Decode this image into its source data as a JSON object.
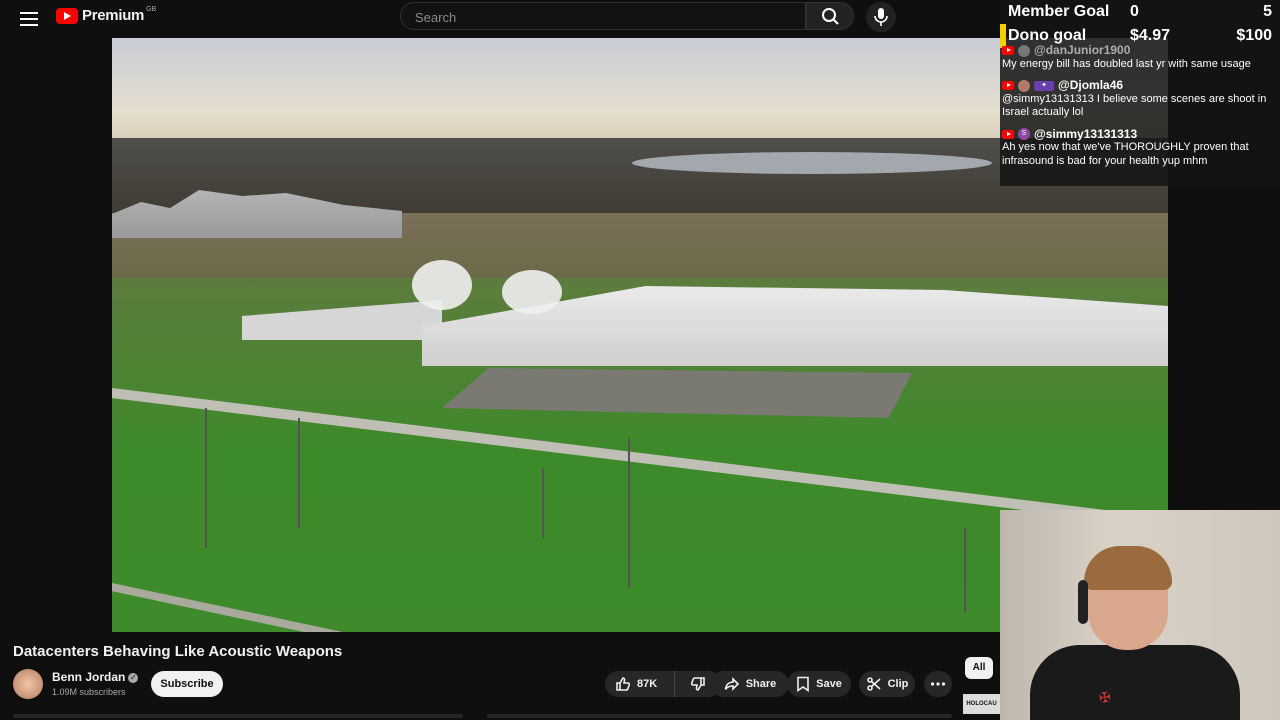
{
  "header": {
    "menu_icon": "hamburger-icon",
    "logo_text": "Premium",
    "logo_region": "GB",
    "search_placeholder": "Search",
    "search_icon": "search-icon",
    "mic_icon": "mic-icon"
  },
  "overlay": {
    "member_goal": {
      "label": "Member Goal",
      "current": "0",
      "target": "5"
    },
    "dono_goal": {
      "label": "Dono goal",
      "current": "$4.97",
      "target": "$100"
    },
    "chat": [
      {
        "user": "@danJunior1900",
        "text": "My energy bill has doubled last yr with same usage"
      },
      {
        "user": "@Djomla46",
        "text": "@simmy13131313 I believe some scenes are shoot in Israel actually lol"
      },
      {
        "user": "@simmy13131313",
        "avatar_letter": "S",
        "text": "Ah yes now that we've THOROUGHLY proven that infrasound is bad for your health yup mhm"
      }
    ]
  },
  "video": {
    "title": "Datacenters Behaving Like Acoustic Weapons"
  },
  "channel": {
    "name": "Benn Jordan",
    "subscribers": "1.09M subscribers",
    "subscribe_label": "Subscribe"
  },
  "actions": {
    "likes": "87K",
    "share_label": "Share",
    "save_label": "Save",
    "clip_label": "Clip"
  },
  "sidebar": {
    "chip_all": "All",
    "thumb_text": "HOLOCAU"
  }
}
